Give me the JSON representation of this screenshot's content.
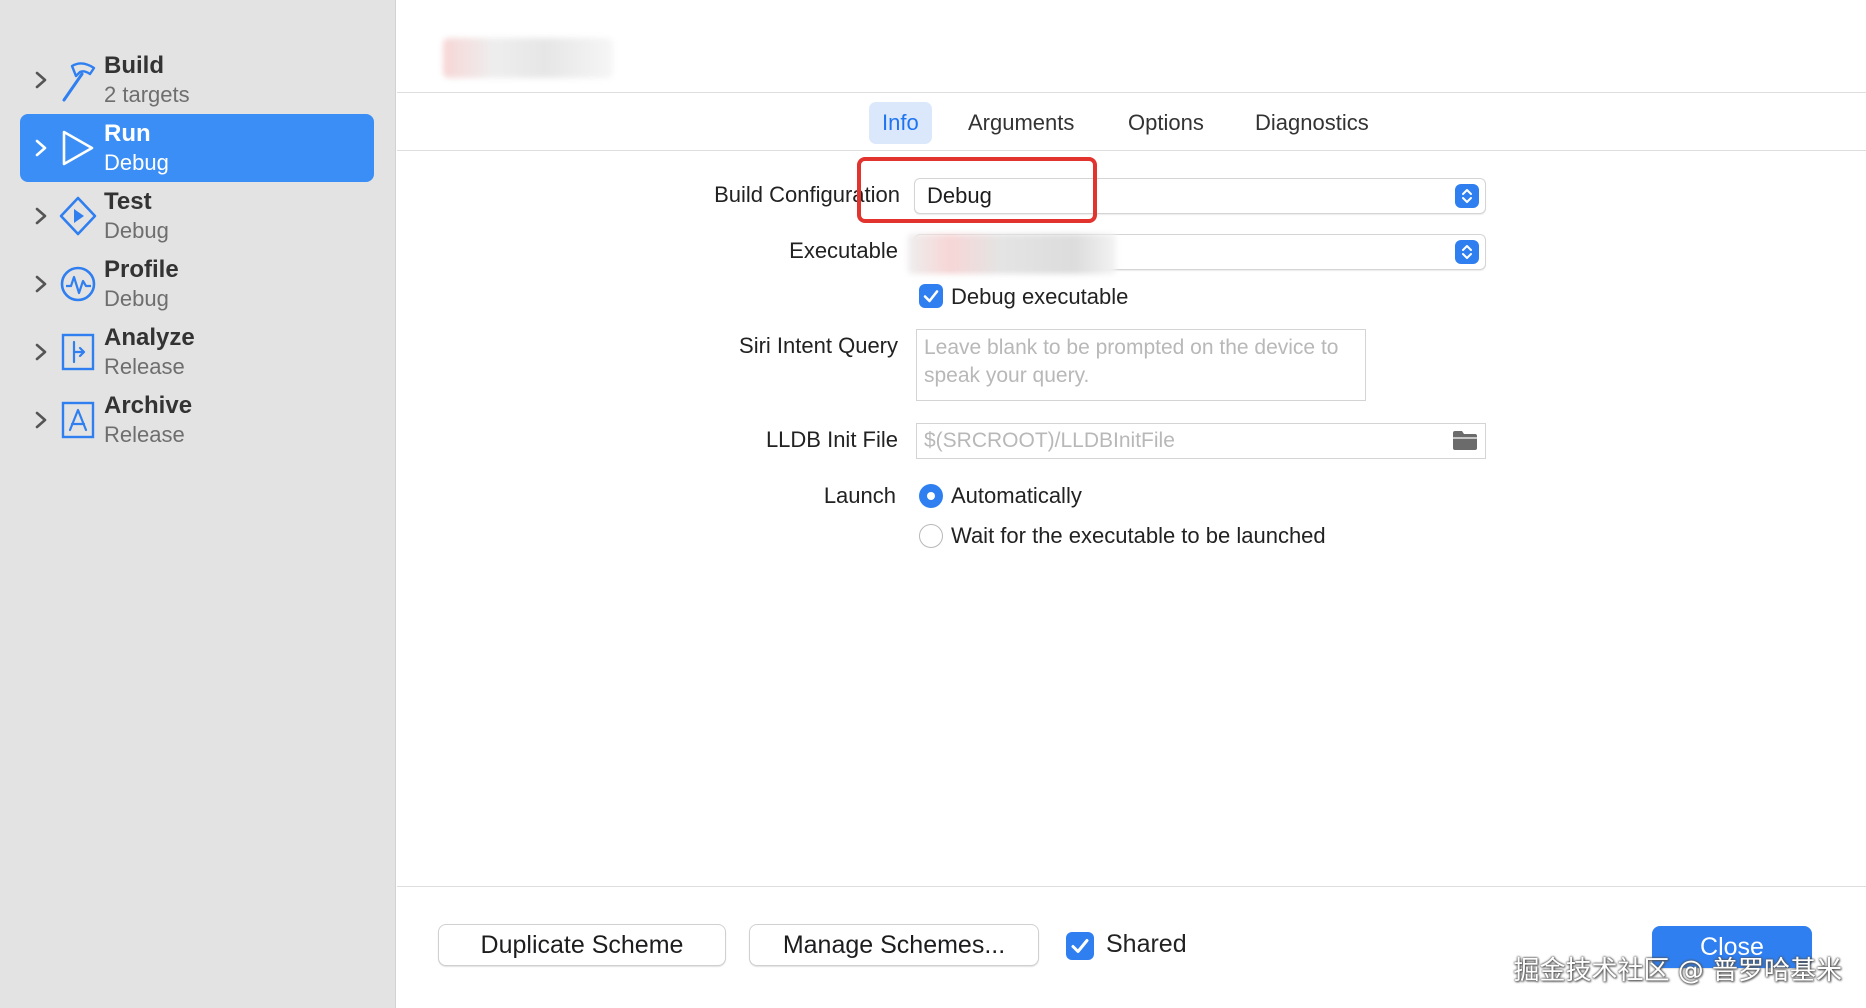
{
  "sidebar": {
    "items": [
      {
        "name": "Build",
        "sub": "2 targets",
        "icon": "hammer-icon"
      },
      {
        "name": "Run",
        "sub": "Debug",
        "icon": "play-icon",
        "selected": true
      },
      {
        "name": "Test",
        "sub": "Debug",
        "icon": "test-diamond-icon"
      },
      {
        "name": "Profile",
        "sub": "Debug",
        "icon": "waveform-icon"
      },
      {
        "name": "Analyze",
        "sub": "Release",
        "icon": "analyze-icon"
      },
      {
        "name": "Archive",
        "sub": "Release",
        "icon": "archive-icon"
      }
    ]
  },
  "tabs": [
    {
      "label": "Info",
      "active": true
    },
    {
      "label": "Arguments"
    },
    {
      "label": "Options"
    },
    {
      "label": "Diagnostics"
    }
  ],
  "form": {
    "build_configuration_label": "Build Configuration",
    "build_configuration_value": "Debug",
    "executable_label": "Executable",
    "debug_executable_label": "Debug executable",
    "siri_label": "Siri Intent Query",
    "siri_placeholder": "Leave blank to be prompted on the device to speak your query.",
    "lldb_label": "LLDB Init File",
    "lldb_placeholder": "$(SRCROOT)/LLDBInitFile",
    "launch_label": "Launch",
    "launch_automatic": "Automatically",
    "launch_wait": "Wait for the executable to be launched"
  },
  "footer": {
    "duplicate": "Duplicate Scheme",
    "manage": "Manage Schemes...",
    "shared": "Shared",
    "close": "Close"
  },
  "watermark": "掘金技术社区 @ 普罗哈基米",
  "colors": {
    "accent": "#2f7ff0",
    "highlight_box": "#e3332f",
    "sidebar_bg": "#e3e3e3"
  }
}
